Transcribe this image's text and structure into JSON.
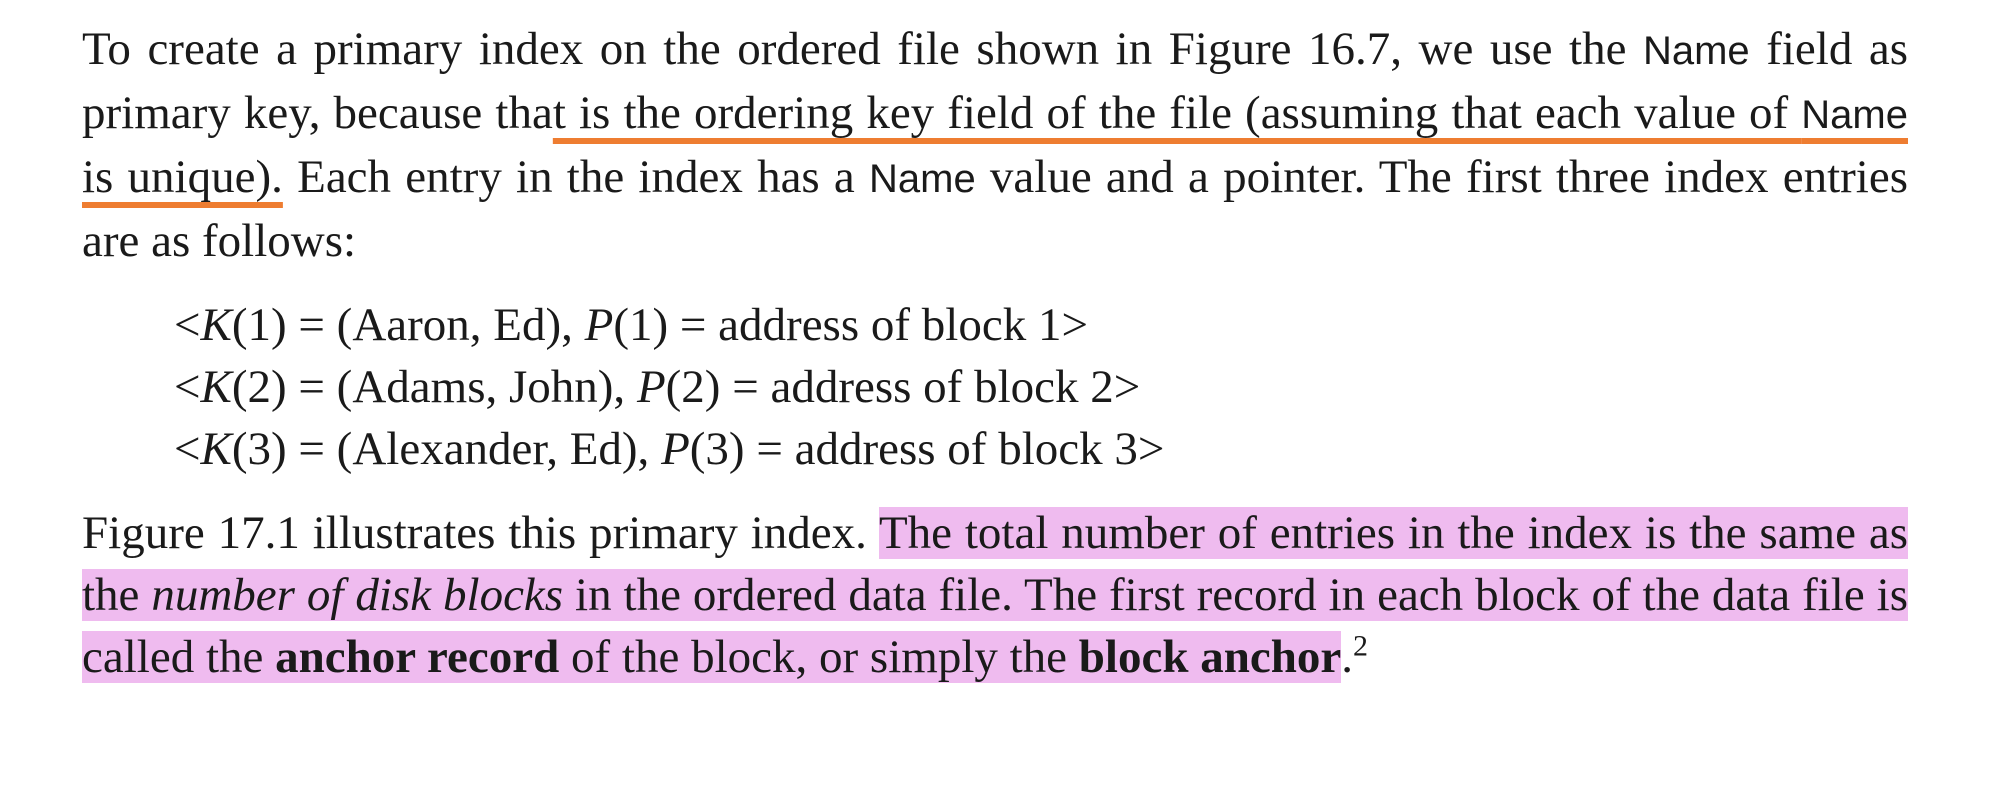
{
  "paragraph1": {
    "s1_a": "To create a primary index on the ordered file shown in Figure 16.7, we use the ",
    "s1_name": "Name",
    "s1_b": " field as primary key, because tha",
    "s1_underlined_a": "t is the ordering key field of the file (assuming that each value of ",
    "s1_underlined_name": "Name",
    "s1_underlined_b": " is unique).",
    "s2_a": " Each entry in the index has a ",
    "s2_name": "Name",
    "s2_b": " value and a pointer. The first three index entries are as follows:"
  },
  "entries": [
    {
      "open": "<",
      "k": "K",
      "k_rest": "(1) = (Aaron, Ed), ",
      "p": "P",
      "p_rest": "(1) = address of block 1>"
    },
    {
      "open": "<",
      "k": "K",
      "k_rest": "(2) = (Adams, John), ",
      "p": "P",
      "p_rest": "(2) = address of block 2>"
    },
    {
      "open": "<",
      "k": "K",
      "k_rest": "(3) = (Alexander, Ed), ",
      "p": "P",
      "p_rest": "(3) = address of block 3>"
    }
  ],
  "paragraph2": {
    "lead": "Figure 17.1 illustrates this primary index. ",
    "hl_a": "The total number of entries in the index is the same as the ",
    "hl_em": "number of disk blocks",
    "hl_b": " in the ordered data file. The first record in each block of the data file is called the ",
    "hl_bold1": "anchor record",
    "hl_c": " of the block, or simply the ",
    "hl_bold2": "block anchor",
    "end": ".",
    "footnote": "2"
  },
  "colors": {
    "underline": "#ee7d31",
    "highlight": "#efbbef",
    "text": "#1a1a1a"
  }
}
